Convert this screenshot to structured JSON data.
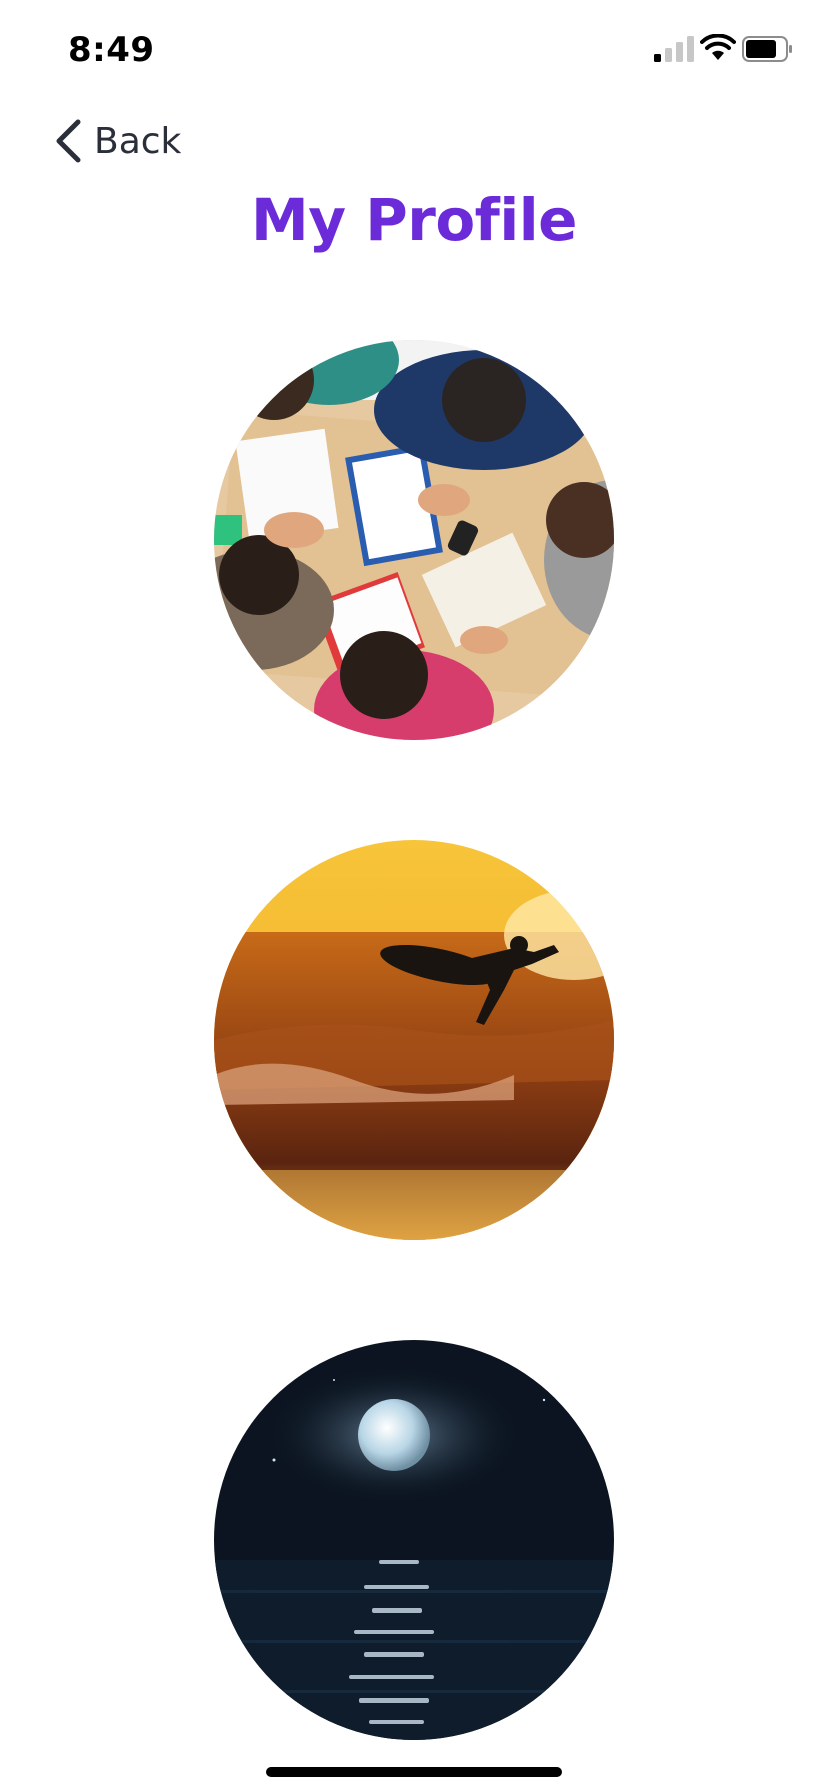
{
  "status_bar": {
    "time": "8:49",
    "icons": [
      "signal-icon",
      "wifi-icon",
      "battery-icon"
    ]
  },
  "nav": {
    "back_label": "Back",
    "back_icon": "chevron-left-icon"
  },
  "page": {
    "title": "My Profile",
    "title_color": "#6c2bd9"
  },
  "photos": [
    {
      "name": "study-group-photo",
      "subject": "students studying around a wooden table"
    },
    {
      "name": "surfer-sunset-photo",
      "subject": "surfer silhouette on a golden wave"
    },
    {
      "name": "moon-ocean-photo",
      "subject": "full moon over dark ocean at night"
    }
  ]
}
